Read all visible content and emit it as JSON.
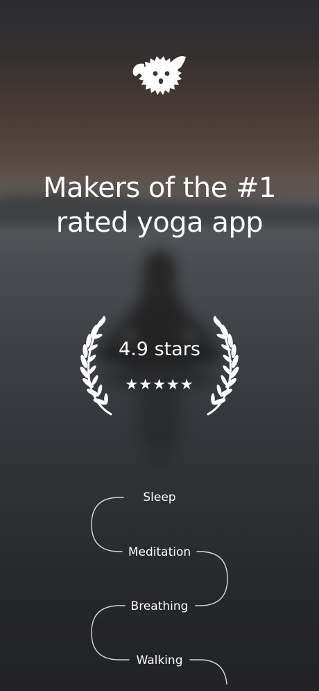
{
  "headline": {
    "line1": "Makers of the #1",
    "line2": "rated yoga app"
  },
  "rating": {
    "text": "4.9 stars",
    "stars_display": "★★★★★",
    "stars": 5
  },
  "activities": [
    {
      "label": "Sleep"
    },
    {
      "label": "Meditation"
    },
    {
      "label": "Breathing"
    },
    {
      "label": "Walking"
    }
  ],
  "icons": {
    "logo": "dog-logo-icon",
    "laurel_left": "laurel-left-icon",
    "laurel_right": "laurel-right-icon"
  },
  "colors": {
    "text": "#ffffff",
    "background_top": "#2b2b30",
    "background_horizon": "#5e534f",
    "background_bottom": "#212224"
  }
}
